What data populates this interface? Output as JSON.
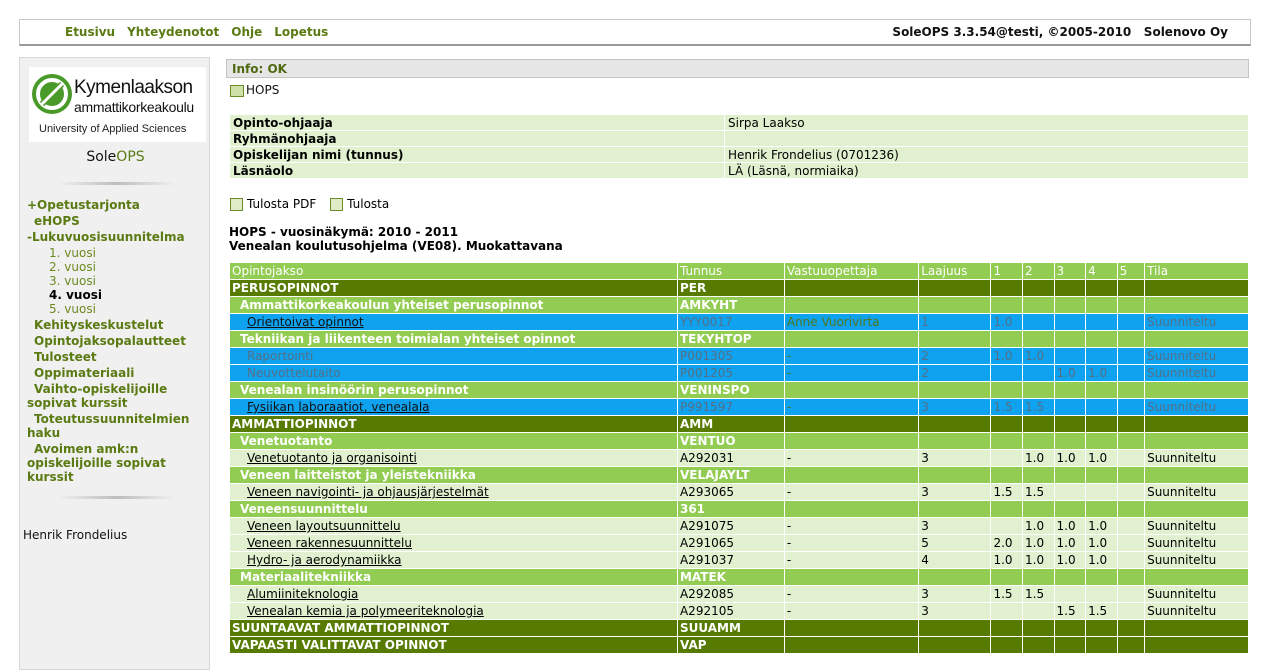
{
  "topnav": [
    "Etusivu",
    "Yhteydenotot",
    "Ohje",
    "Lopetus"
  ],
  "brand": "SoleOPS 3.3.54@testi, ©2005-2010   Solenovo Oy",
  "logo": {
    "line1": "Kymenlaakson",
    "line2": "ammattikorkeakoulu",
    "line3": "University of Applied Sciences"
  },
  "app_name": {
    "prefix": "Sole",
    "suffix": "OPS"
  },
  "menu": {
    "opetustarjonta": "+Opetustarjonta",
    "ehops": "eHOPS",
    "lukuvuosi": "-Lukuvuosisuunnitelma",
    "years": [
      "1. vuosi",
      "2. vuosi",
      "3. vuosi",
      "4. vuosi",
      "5. vuosi"
    ],
    "current_year_index": 3,
    "kehitys": "Kehityskeskustelut",
    "palautteet": "Opintojaksopalautteet",
    "tulosteet": "Tulosteet",
    "oppimateriaali": "Oppimateriaali",
    "vaihto": "Vaihto-opiskelijoille sopivat kurssit",
    "toteutus": "Toteutussuunnitelmien haku",
    "avoimen": "Avoimen amk:n opiskelijoille sopivat kurssit"
  },
  "username": "Henrik Frondelius",
  "info": "Info: OK",
  "hops_link": "HOPS",
  "student_info": [
    {
      "label": "Opinto-ohjaaja",
      "value": "Sirpa Laakso"
    },
    {
      "label": "Ryhmänohjaaja",
      "value": ""
    },
    {
      "label": "Opiskelijan nimi (tunnus)",
      "value": "Henrik Frondelius (0701236)"
    },
    {
      "label": "Läsnäolo",
      "value": "LÄ (Läsnä, normiaika)"
    }
  ],
  "print": {
    "pdf": "Tulosta PDF",
    "print": "Tulosta"
  },
  "heading": {
    "line1": "HOPS - vuosinäkymä: 2010 - 2011",
    "line2": "Venealan koulutusohjelma (VE08). Muokattavana"
  },
  "table": {
    "headers": [
      "Opintojakso",
      "Tunnus",
      "Vastuuopettaja",
      "Laajuus",
      "1",
      "2",
      "3",
      "4",
      "5",
      "Tila"
    ],
    "rows": [
      {
        "type": "lvl1",
        "name": "PERUSOPINNOT",
        "code": "PER"
      },
      {
        "type": "lvl2",
        "name": "Ammattikorkeakoulun yhteiset perusopinnot",
        "code": "AMKYHT"
      },
      {
        "type": "blue",
        "name": "Orientoivat opinnot",
        "link": true,
        "code": "YYY0017",
        "teacher": "Anne Vuorivirta",
        "credits": "1",
        "p1": "1.0",
        "p2": "",
        "p3": "",
        "p4": "",
        "p5": "",
        "status": "Suunniteltu"
      },
      {
        "type": "lvl2",
        "name": "Tekniikan ja liikenteen toimialan yhteiset opinnot",
        "code": "TEKYHTOP"
      },
      {
        "type": "blue",
        "name": "Raportointi",
        "link": false,
        "code": "P001305",
        "teacher": "-",
        "credits": "2",
        "p1": "1.0",
        "p2": "1.0",
        "p3": "",
        "p4": "",
        "p5": "",
        "status": "Suunniteltu"
      },
      {
        "type": "blue",
        "name": "Neuvottelutaito",
        "link": false,
        "code": "P001205",
        "teacher": "-",
        "credits": "2",
        "p1": "",
        "p2": "",
        "p3": "1.0",
        "p4": "1.0",
        "p5": "",
        "status": "Suunniteltu"
      },
      {
        "type": "lvl2",
        "name": "Venealan insinöörin perusopinnot",
        "code": "VENINSPO"
      },
      {
        "type": "blue",
        "name": "Fysiikan laboraatiot, venealala",
        "link": true,
        "code": "P991597",
        "teacher": "-",
        "credits": "3",
        "p1": "1.5",
        "p2": "1.5",
        "p3": "",
        "p4": "",
        "p5": "",
        "status": "Suunniteltu"
      },
      {
        "type": "lvl1",
        "name": "AMMATTIOPINNOT",
        "code": "AMM"
      },
      {
        "type": "lvl2",
        "name": "Venetuotanto",
        "code": "VENTUO"
      },
      {
        "type": "course",
        "name": "Venetuotanto ja organisointi",
        "code": "A292031",
        "teacher": "-",
        "credits": "3",
        "p1": "",
        "p2": "1.0",
        "p3": "1.0",
        "p4": "1.0",
        "p5": "",
        "status": "Suunniteltu"
      },
      {
        "type": "lvl2",
        "name": "Veneen laitteistot ja yleistekniikka",
        "code": "VELAJAYLT"
      },
      {
        "type": "course",
        "name": "Veneen navigointi- ja ohjausjärjestelmät",
        "code": "A293065",
        "teacher": "-",
        "credits": "3",
        "p1": "1.5",
        "p2": "1.5",
        "p3": "",
        "p4": "",
        "p5": "",
        "status": "Suunniteltu"
      },
      {
        "type": "lvl2",
        "name": "Veneensuunnittelu",
        "code": "361"
      },
      {
        "type": "course",
        "name": "Veneen layoutsuunnittelu",
        "code": "A291075",
        "teacher": "-",
        "credits": "3",
        "p1": "",
        "p2": "1.0",
        "p3": "1.0",
        "p4": "1.0",
        "p5": "",
        "status": "Suunniteltu"
      },
      {
        "type": "course",
        "name": "Veneen rakennesuunnittelu",
        "code": "A291065",
        "teacher": "-",
        "credits": "5",
        "p1": "2.0",
        "p2": "1.0",
        "p3": "1.0",
        "p4": "1.0",
        "p5": "",
        "status": "Suunniteltu"
      },
      {
        "type": "course",
        "name": "Hydro- ja aerodynamiikka",
        "code": "A291037",
        "teacher": "-",
        "credits": "4",
        "p1": "1.0",
        "p2": "1.0",
        "p3": "1.0",
        "p4": "1.0",
        "p5": "",
        "status": "Suunniteltu"
      },
      {
        "type": "lvl2",
        "name": "Materiaalitekniikka",
        "code": "MATEK"
      },
      {
        "type": "course",
        "name": "Alumiiniteknologia",
        "code": "A292085",
        "teacher": "-",
        "credits": "3",
        "p1": "1.5",
        "p2": "1.5",
        "p3": "",
        "p4": "",
        "p5": "",
        "status": "Suunniteltu"
      },
      {
        "type": "course",
        "name": "Venealan kemia ja polymeeriteknologia",
        "code": "A292105",
        "teacher": "-",
        "credits": "3",
        "p1": "",
        "p2": "",
        "p3": "1.5",
        "p4": "1.5",
        "p5": "",
        "status": "Suunniteltu"
      },
      {
        "type": "lvl1",
        "name": "SUUNTAAVAT AMMATTIOPINNOT",
        "code": "SUUAMM"
      },
      {
        "type": "lvl1",
        "name": "VAPAASTI VALITTAVAT OPINNOT",
        "code": "VAP"
      }
    ]
  }
}
